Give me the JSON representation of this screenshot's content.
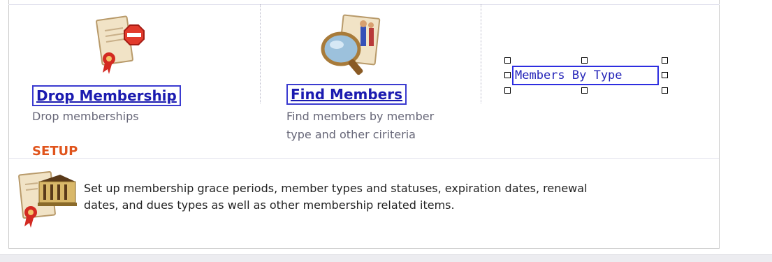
{
  "tiles": [
    {
      "link": "Drop Membership",
      "desc": "Drop memberships",
      "icon": "certificate-stop-icon"
    },
    {
      "link": "Find Members",
      "desc_line1": "Find members by member",
      "desc_line2": "type and other ciriteria",
      "icon": "magnifier-people-icon"
    },
    {
      "link": "Members By Type"
    }
  ],
  "setup": {
    "title": "SETUP",
    "desc_line1": "Set up membership grace periods, member types and statuses, expiration dates, renewal",
    "desc_line2": "dates, and dues types as well as other membership related items.",
    "icon": "certificate-building-icon"
  },
  "colors": {
    "link": "#1b1bb0",
    "accent": "#e0541c",
    "selection": "#2d2de0"
  }
}
